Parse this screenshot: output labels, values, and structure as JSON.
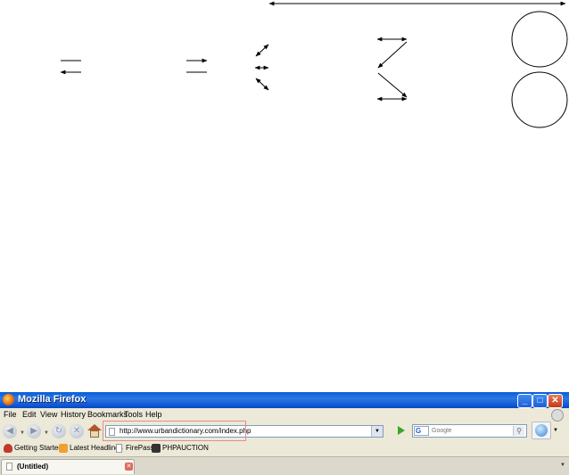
{
  "browser": {
    "window_title": "Mozilla Firefox",
    "menu": [
      "File",
      "Edit",
      "View",
      "History",
      "Bookmarks",
      "Tools",
      "Help"
    ],
    "url": "http://www.urbandictionary.com/index.php",
    "search_placeholder": "Google",
    "search_engine_letter": "G",
    "bookmarks": [
      "Getting Started",
      "Latest Headlines",
      "FirePass",
      "PHPAUCTION"
    ],
    "tab_title": "(Untitled)",
    "icons": {
      "minimize": "minimize-icon",
      "maximize": "maximize-icon",
      "close": "close-icon",
      "back": "back-arrow-icon",
      "forward": "forward-arrow-icon",
      "reload": "reload-icon",
      "stop": "stop-icon",
      "home": "home-icon",
      "go": "go-arrow-icon",
      "search": "magnifier-icon"
    },
    "colors": {
      "titlebar": "#0a5cd8",
      "chrome": "#ece9d8",
      "highlight_box": "#e88b8b"
    }
  }
}
